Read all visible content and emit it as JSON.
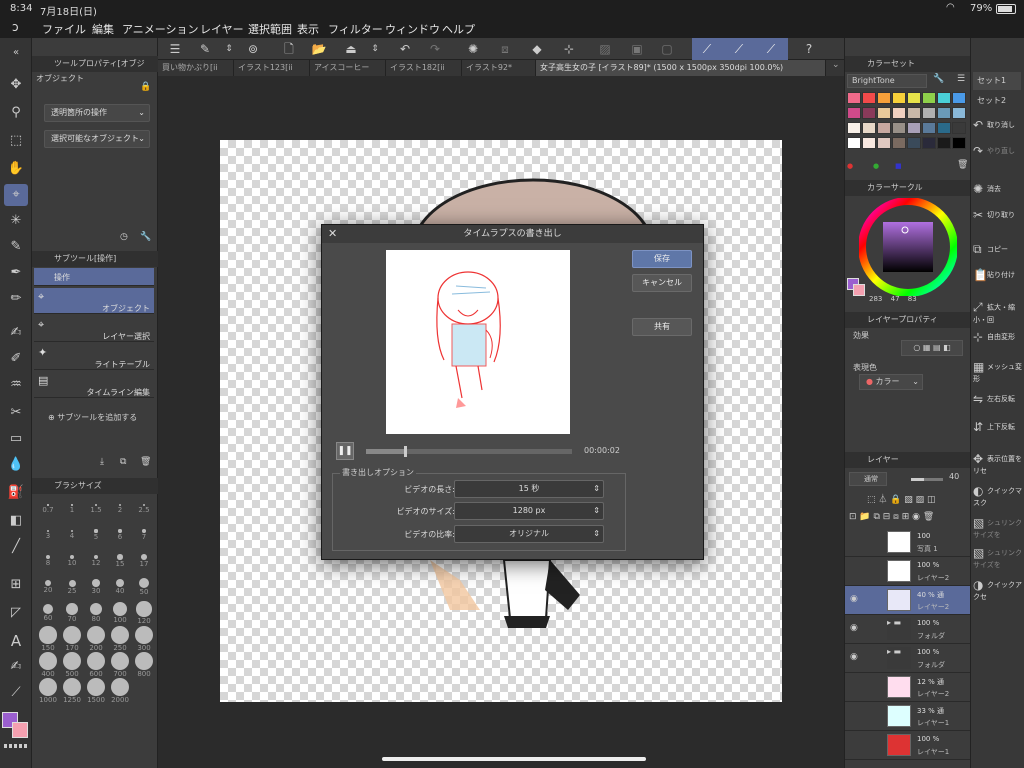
{
  "status": {
    "time": "8:34",
    "date": "7月18日(日)",
    "battery": "79%"
  },
  "menu": [
    "ファイル",
    "編集",
    "アニメーション",
    "レイヤー",
    "選択範囲",
    "表示",
    "フィルター",
    "ウィンドウ",
    "ヘルプ"
  ],
  "tabs": [
    "買い物かぶり[ii",
    "イラスト123[ii",
    "アイスコーヒー",
    "イラスト182[ii",
    "イラスト92*",
    "女子高生女の子 [イラスト89]* (1500 x 1500px 350dpi 100.0%)"
  ],
  "left_panel": {
    "tool_property_title": "ツールプロパティ[オブジ",
    "object_label": "オブジェクト",
    "select_transparent": "透明箇所の操作",
    "select_object": "選択可能なオブジェクト",
    "subtool_title": "サブツール[操作]",
    "subtools": [
      "操作",
      "オブジェクト",
      "レイヤー選択",
      "ライトテーブル",
      "タイムライン編集"
    ],
    "add_subtool": "サブツールを追加する",
    "brushsize_title": "ブラシサイズ",
    "brush_sizes": [
      "0.7",
      "1",
      "1.5",
      "2",
      "2.5",
      "3",
      "4",
      "5",
      "6",
      "7",
      "8",
      "10",
      "12",
      "15",
      "17",
      "20",
      "25",
      "30",
      "40",
      "50",
      "60",
      "70",
      "80",
      "100",
      "120",
      "150",
      "170",
      "200",
      "250",
      "300",
      "400",
      "500",
      "600",
      "700",
      "800",
      "1000",
      "1250",
      "1500",
      "2000"
    ]
  },
  "color_set": {
    "title": "カラーセット",
    "preset": "BrightTone",
    "colors": [
      "#f06a8a",
      "#f24a4a",
      "#f7a03a",
      "#f7d03a",
      "#e7e34a",
      "#8ed04a",
      "#4ad0d8",
      "#4a9ae8",
      "#d04a8a",
      "#8a3a5a",
      "#e8c89a",
      "#f0d0c0",
      "#c8b8a8",
      "#b0b0b0",
      "#6a9ab8",
      "#8ab8d8",
      "#f8f0e8",
      "#e8d8c8",
      "#c8a8a0",
      "#989088",
      "#a8a0b8",
      "#5a7a9a",
      "#2a6a8a",
      "#3a3a3a",
      "#ffffff",
      "#f8e8e0",
      "#e0c8c0",
      "#7a6a60",
      "#3a4a5a",
      "#2a2a3a",
      "#1a1a1a",
      "#000000"
    ]
  },
  "color_circle": {
    "title": "カラーサークル",
    "h": "283",
    "s": "47",
    "v": "83"
  },
  "layer_property": {
    "title": "レイヤープロパティ",
    "effect": "効果",
    "expression_color": "表現色",
    "color_label": "カラー"
  },
  "layers_panel": {
    "title": "レイヤー",
    "blend": "通常",
    "opacity": "40",
    "layers": [
      {
        "pct": "100",
        "name": "写真 1"
      },
      {
        "pct": "100 %",
        "name": "レイヤー2"
      },
      {
        "pct": "40 % 通",
        "name": "レイヤー2"
      },
      {
        "pct": "100 %",
        "name": "フォルダ"
      },
      {
        "pct": "100 %",
        "name": "フォルダ"
      },
      {
        "pct": "12 % 通",
        "name": "レイヤー2"
      },
      {
        "pct": "33 % 通",
        "name": "レイヤー1"
      },
      {
        "pct": "100 %",
        "name": "レイヤー1"
      }
    ]
  },
  "right_edge": {
    "set1": "セット1",
    "set2": "セット2",
    "commands": [
      "取り消し",
      "やり直し",
      "消去",
      "切り取り",
      "コピー",
      "貼り付け",
      "拡大・縮小・回",
      "自由変形",
      "メッシュ変形",
      "左右反転",
      "上下反転",
      "表示位置をリセ",
      "クイックマスク",
      "シュリンクサイズを",
      "シュリンクサイズを",
      "クイックアクセ"
    ]
  },
  "dialog": {
    "title": "タイムラプスの書き出し",
    "save": "保存",
    "cancel": "キャンセル",
    "share": "共有",
    "time": "00:00:02",
    "options_title": "書き出しオプション",
    "video_length_label": "ビデオの長さ:",
    "video_length": "15 秒",
    "video_size_label": "ビデオのサイズ:",
    "video_size": "1280 px",
    "video_ratio_label": "ビデオの比率:",
    "video_ratio": "オリジナル",
    "progress": 0.19
  }
}
